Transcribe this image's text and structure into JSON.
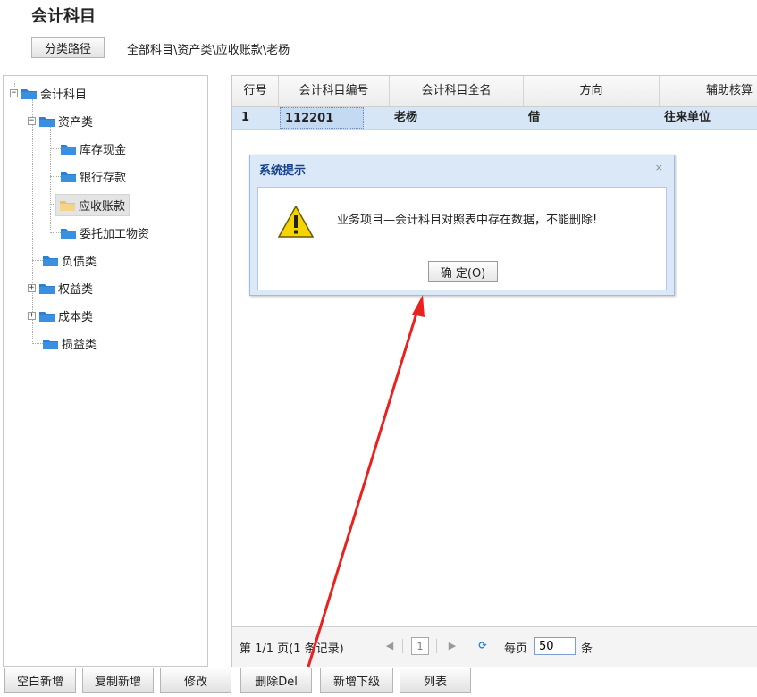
{
  "page": {
    "title": "会计科目"
  },
  "header": {
    "path_button": "分类路径",
    "breadcrumb": "全部科目\\资产类\\应收账款\\老杨"
  },
  "tree": {
    "root": "会计科目",
    "nodes": [
      {
        "label": "资产类"
      },
      {
        "label": "库存现金"
      },
      {
        "label": "银行存款"
      },
      {
        "label": "应收账款"
      },
      {
        "label": "委托加工物资"
      },
      {
        "label": "负债类"
      },
      {
        "label": "权益类"
      },
      {
        "label": "成本类"
      },
      {
        "label": "损益类"
      }
    ],
    "toggle_minus": "−",
    "toggle_plus": "+"
  },
  "grid": {
    "columns": [
      "行号",
      "会计科目编号",
      "会计科目全名",
      "方向",
      "辅助核算"
    ],
    "rows": [
      {
        "row_no": "1",
        "code": "112201",
        "name": "老杨",
        "direction": "借",
        "aux": "往来单位"
      }
    ]
  },
  "pager": {
    "page_text": "第 1/1 页(1 条记录)",
    "current_page": "1",
    "per_page_label": "每页",
    "per_page_value": "50",
    "unit": "条",
    "first": "◀",
    "next": "▶",
    "refresh": "⟳"
  },
  "dialog": {
    "title": "系统提示",
    "close": "×",
    "message": "业务项目—会计科目对照表中存在数据，不能删除!",
    "ok": "确 定(O)"
  },
  "toolbar": {
    "buttons": [
      "空白新增",
      "复制新增",
      "修改",
      "删除Del",
      "新增下级",
      "列表"
    ]
  },
  "colors": {
    "folder": "#2f7fd0",
    "folder_open": "#f3d58a",
    "arrow": "#e8231f",
    "selection": "#d6e6f7"
  }
}
